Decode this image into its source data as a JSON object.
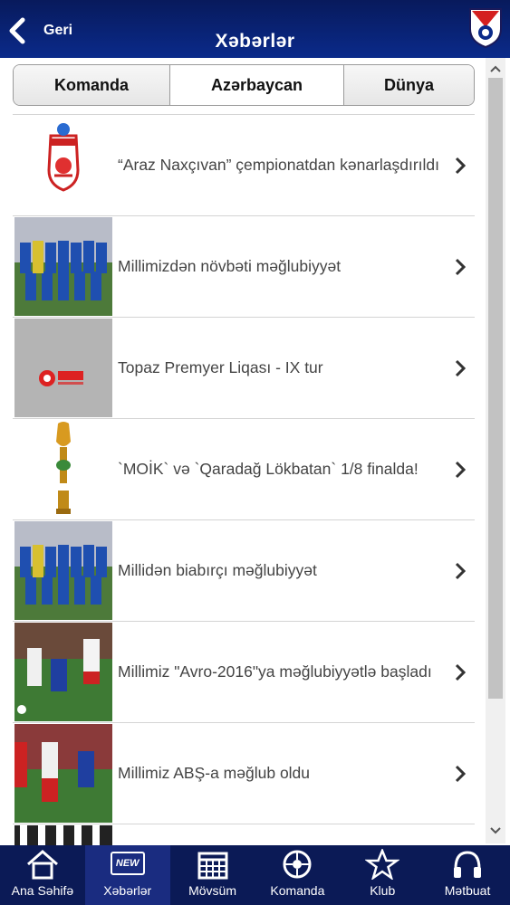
{
  "header": {
    "back_label": "Geri",
    "title": "Xəbərlər",
    "logo_icon": "qarabag-club-crest"
  },
  "segments": [
    {
      "label": "Komanda",
      "active": false
    },
    {
      "label": "Azərbaycan",
      "active": true
    },
    {
      "label": "Dünya",
      "active": false
    }
  ],
  "news": [
    {
      "title": "“Araz Naxçıvan” çempionatdan kənarlaşdırıldı",
      "thumb": "araz-club-crest"
    },
    {
      "title": "Millimizdən növbəti məğlubiyyət",
      "thumb": "national-team-photo"
    },
    {
      "title": "Topaz Premyer Liqası - IX tur",
      "thumb": "topaz-league-logo"
    },
    {
      "title": "`MOİK` və `Qaradağ Lökbatan` 1/8 finalda!",
      "thumb": "cup-trophy"
    },
    {
      "title": "Millidən biabırçı məğlubiyyət",
      "thumb": "national-team-photo"
    },
    {
      "title": "Millimiz \"Avro-2016\"ya məğlubiyyətlə başladı",
      "thumb": "match-action-photo"
    },
    {
      "title": "Millimiz ABŞ-a məğlub oldu",
      "thumb": "usa-match-photo"
    }
  ],
  "tabbar": [
    {
      "label": "Ana Səhifə",
      "icon": "home-icon",
      "active": false
    },
    {
      "label": "Xəbərlər",
      "icon": "new-badge-icon",
      "badge": "NEW",
      "active": true
    },
    {
      "label": "Mövsüm",
      "icon": "calendar-icon",
      "active": false
    },
    {
      "label": "Komanda",
      "icon": "football-icon",
      "active": false
    },
    {
      "label": "Klub",
      "icon": "star-icon",
      "active": false
    },
    {
      "label": "Mətbuat",
      "icon": "headphones-icon",
      "active": false
    }
  ],
  "colors": {
    "header_bg": "#0a2a8a",
    "tabbar_bg": "#0b1a56",
    "active_tab_bg": "#1a2c80"
  }
}
